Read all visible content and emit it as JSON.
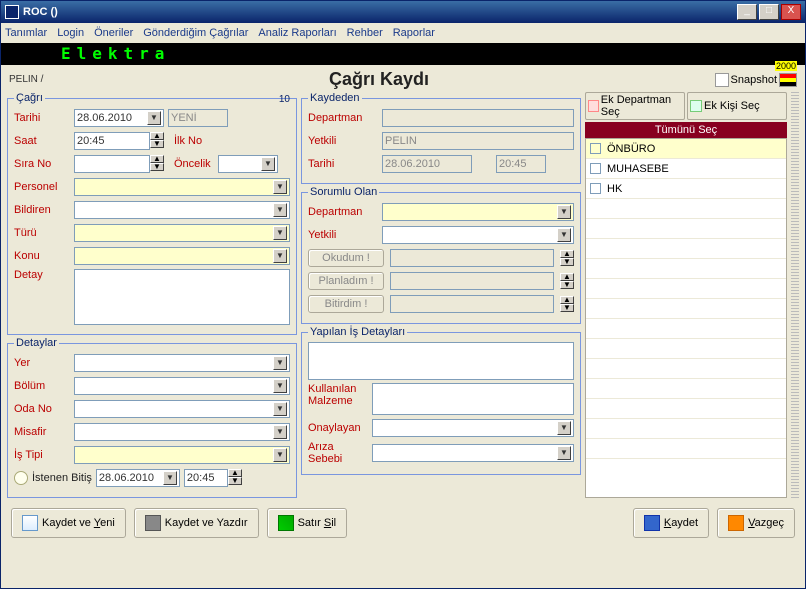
{
  "window": {
    "title": "ROC ()"
  },
  "menu": {
    "tanimlar": "Tanımlar",
    "login": "Login",
    "oneriler": "Öneriler",
    "gonderdigim": "Gönderdiğim Çağrılar",
    "analiz": "Analiz Raporları",
    "rehber": "Rehber",
    "raporlar": "Raporlar"
  },
  "led": "Elektra",
  "breadcrumb": "PELIN /",
  "pagetitle": "Çağrı Kaydı",
  "snapshot": "Snapshot",
  "cagri": {
    "legend": "Çağrı",
    "corner": "10",
    "tarihi_lab": "Tarihi",
    "tarihi_val": "28.06.2010",
    "yeni": "YENİ",
    "saat_lab": "Saat",
    "saat_val": "20:45",
    "ilkno_lab": "İlk No",
    "sira_lab": "Sıra No",
    "oncelik_lab": "Öncelik",
    "personel_lab": "Personel",
    "bildiren_lab": "Bildiren",
    "turu_lab": "Türü",
    "konu_lab": "Konu",
    "detay_lab": "Detay"
  },
  "detaylar": {
    "legend": "Detaylar",
    "yer_lab": "Yer",
    "bolum_lab": "Bölüm",
    "oda_lab": "Oda No",
    "misafir_lab": "Misafir",
    "istipi_lab": "İş Tipi",
    "istenen_lab": "İstenen Bitiş",
    "istenen_date": "28.06.2010",
    "istenen_time": "20:45"
  },
  "kaydeden": {
    "legend": "Kaydeden",
    "dep_lab": "Departman",
    "yetkili_lab": "Yetkili",
    "yetkili_val": "PELIN",
    "tarihi_lab": "Tarihi",
    "tarihi_val": "28.06.2010",
    "saat_val": "20:45"
  },
  "sorumlu": {
    "legend": "Sorumlu Olan",
    "dep_lab": "Departman",
    "yetkili_lab": "Yetkili",
    "okudum": "Okudum !",
    "planladim": "Planladım !",
    "bitirdim": "Bitirdim !"
  },
  "yapilan": {
    "legend": "Yapılan İş Detayları",
    "malzeme_lab": "Kullanılan Malzeme",
    "onaylayan_lab": "Onaylayan",
    "ariza_lab": "Arıza Sebebi"
  },
  "right": {
    "ekdep": "Ek Departman Seç",
    "ekkisi": "Ek Kişi Seç",
    "tumunu": "Tümünü Seç",
    "items": [
      "ÖNBÜRO",
      "MUHASEBE",
      "HK"
    ]
  },
  "buttons": {
    "kaydetyeni": "Kaydet ve Yeni",
    "kaydetyaz": "Kaydet ve Yazdır",
    "satirsil": "Satır Sil",
    "kaydet": "Kaydet",
    "vazgec": "Vazgeç"
  }
}
